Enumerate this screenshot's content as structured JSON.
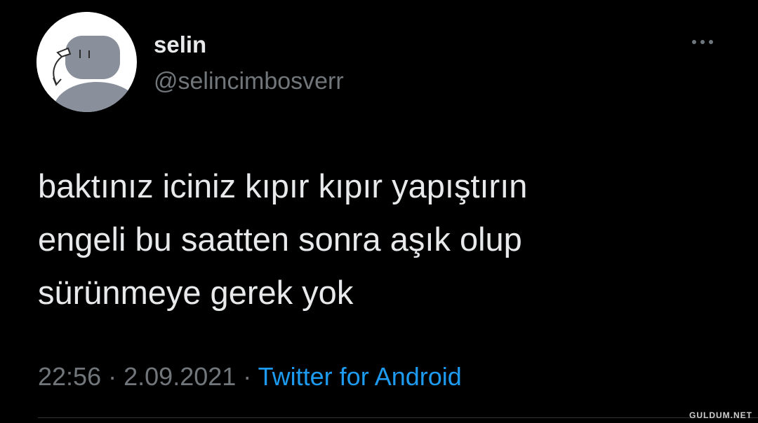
{
  "user": {
    "display_name": "selin",
    "handle": "@selincimbosverr",
    "avatar_icon": "default-avatar-drawing-icon"
  },
  "tweet": {
    "lines": [
      "baktınız iciniz kıpır kıpır yapıştırın",
      "engeli bu saatten sonra aşık olup",
      "sürünmeye gerek yok"
    ],
    "time": "22:56",
    "separator": "·",
    "date": "2.09.2021",
    "source": "Twitter for Android"
  },
  "more_icon": "more-horizontal-icon",
  "watermark": "GULDUM.NET",
  "colors": {
    "background": "#000000",
    "text": "#e7e9ea",
    "muted": "#71767b",
    "link": "#1d9bf0"
  }
}
